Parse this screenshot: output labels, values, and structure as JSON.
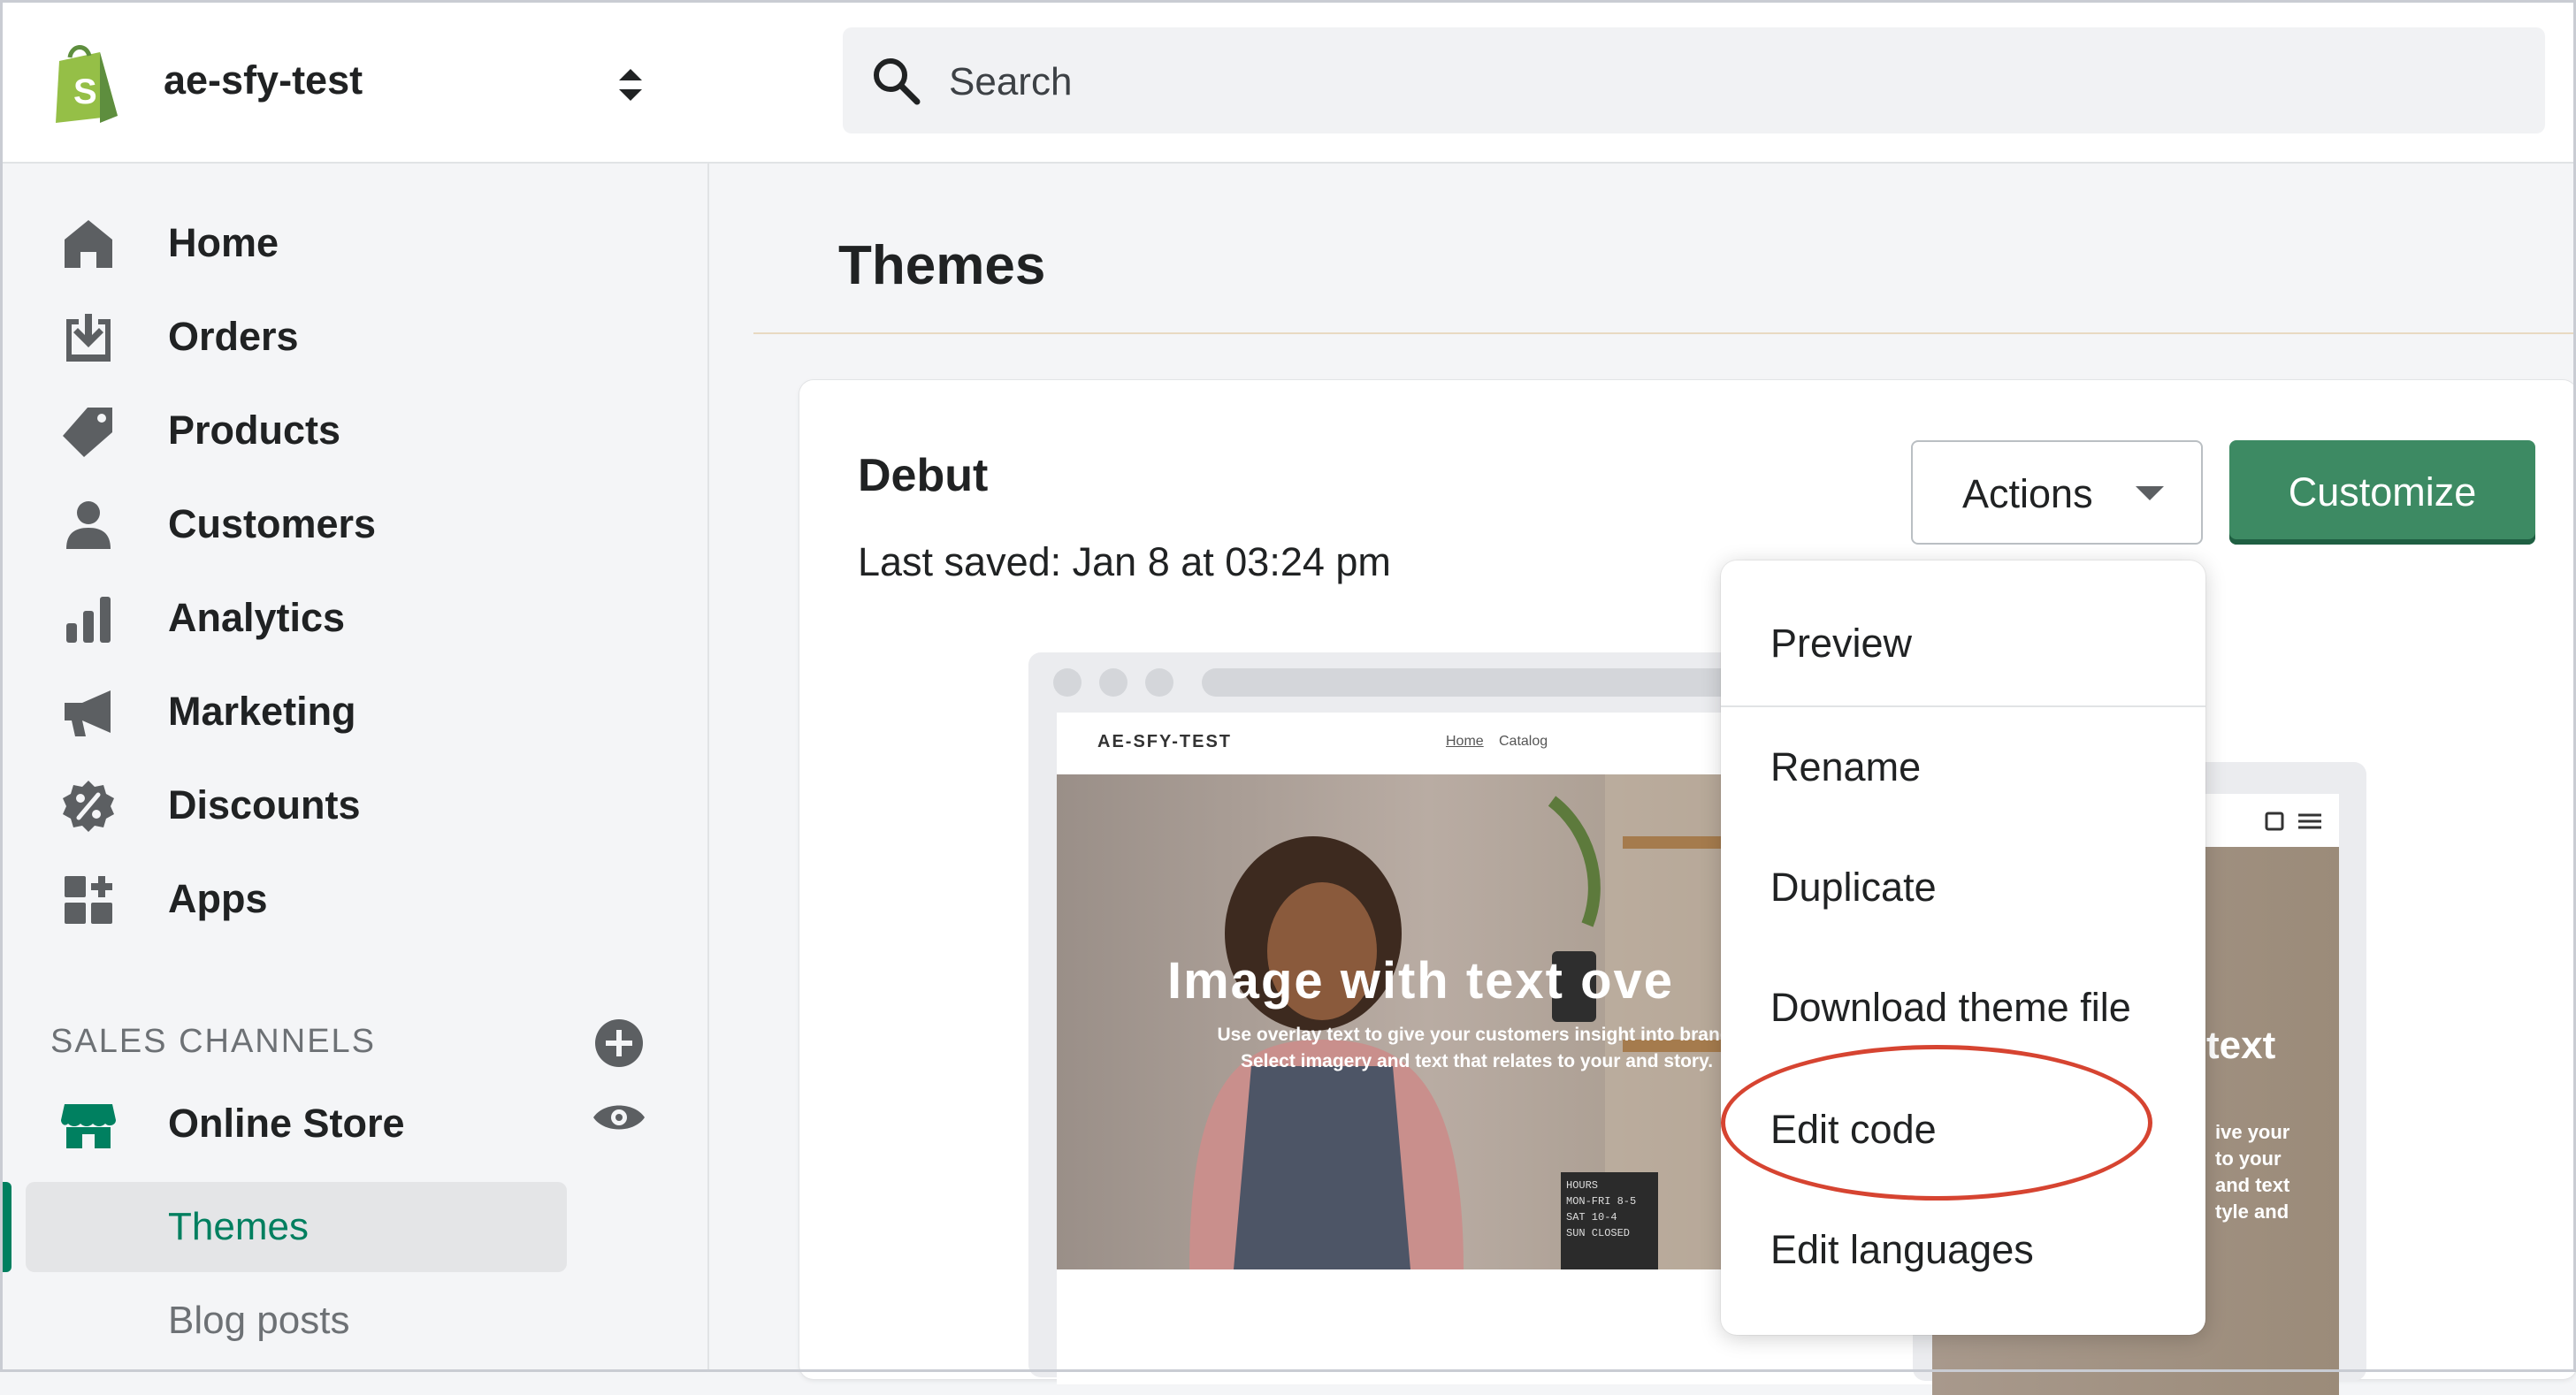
{
  "store": {
    "name": "ae-sfy-test"
  },
  "search": {
    "placeholder": "Search"
  },
  "sidebar": {
    "items": [
      {
        "label": "Home",
        "icon": "home-icon"
      },
      {
        "label": "Orders",
        "icon": "orders-icon"
      },
      {
        "label": "Products",
        "icon": "tag-icon"
      },
      {
        "label": "Customers",
        "icon": "person-icon"
      },
      {
        "label": "Analytics",
        "icon": "bar-chart-icon"
      },
      {
        "label": "Marketing",
        "icon": "megaphone-icon"
      },
      {
        "label": "Discounts",
        "icon": "discount-icon"
      },
      {
        "label": "Apps",
        "icon": "apps-icon"
      }
    ],
    "sales_channels_title": "SALES CHANNELS",
    "online_store_label": "Online Store",
    "sub_items": [
      {
        "label": "Themes",
        "active": true
      },
      {
        "label": "Blog posts",
        "active": false
      }
    ]
  },
  "main": {
    "page_title": "Themes",
    "theme": {
      "name": "Debut",
      "last_saved": "Last saved: Jan 8 at 03:24 pm"
    },
    "actions_label": "Actions",
    "customize_label": "Customize"
  },
  "preview": {
    "store_logo": "AE-SFY-TEST",
    "nav": [
      "Home",
      "Catalog"
    ],
    "hero_title": "Image with text ove",
    "hero_subtitle": "Use overlay text to give your customers insight into brand. Select imagery and text that relates to your and story.",
    "hours_board": [
      "HOURS",
      "MON-FRI 8-5",
      "SAT    10-4",
      "SUN   CLOSED"
    ],
    "mobile_title": "text",
    "mobile_subtitle": [
      "ive your",
      "to your",
      "and text",
      "tyle and"
    ]
  },
  "dropdown": {
    "items": [
      "Preview",
      "Rename",
      "Duplicate",
      "Download theme file",
      "Edit code",
      "Edit languages"
    ],
    "highlighted": "Edit code"
  },
  "colors": {
    "accent": "#008060",
    "customize_button": "#3d8a63",
    "highlight_ellipse": "#d64431"
  }
}
